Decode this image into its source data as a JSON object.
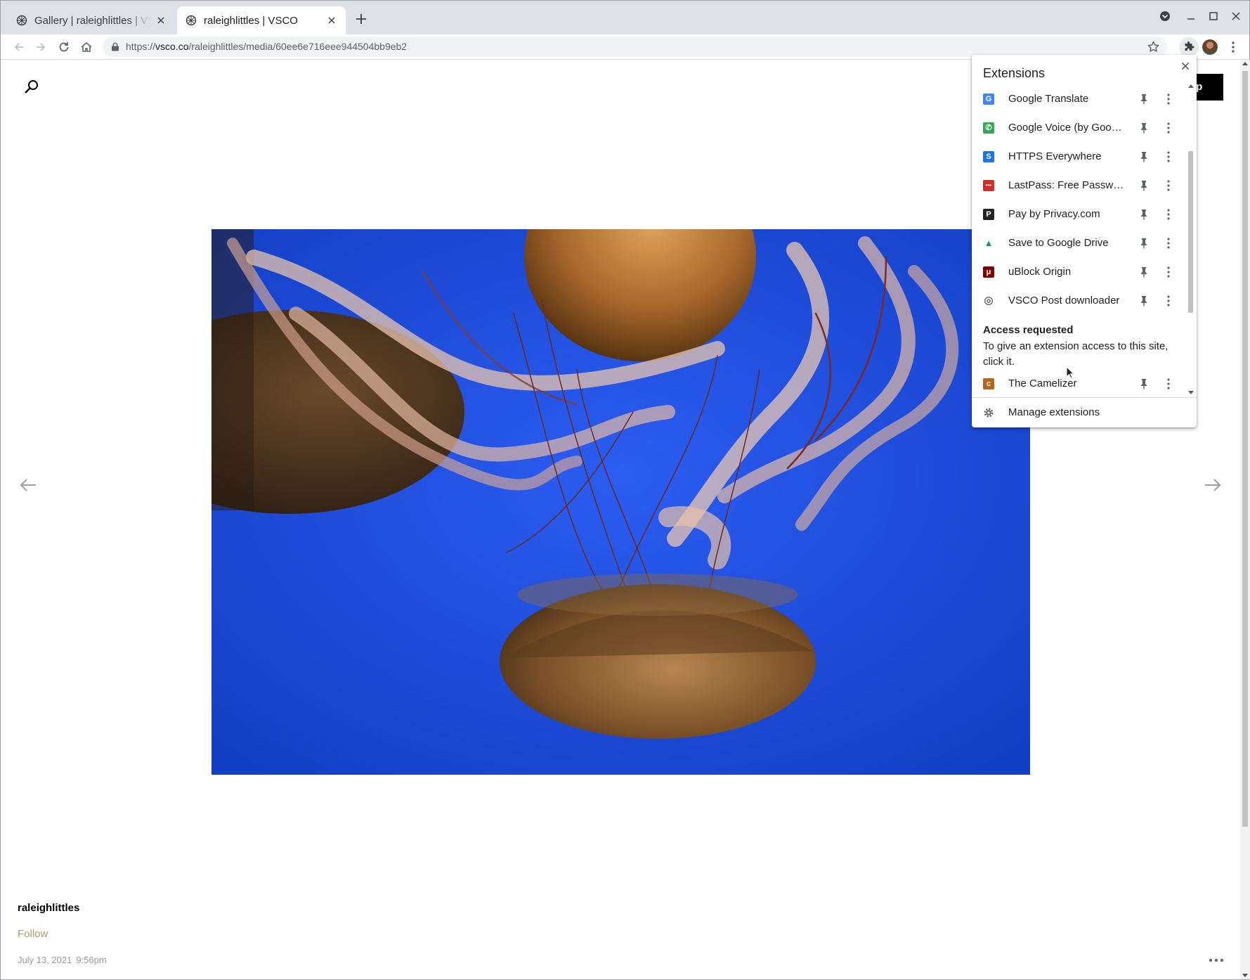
{
  "tabs": [
    {
      "title": "Gallery | raleighlittles | VSCO",
      "icon": "vsco-favicon-icon",
      "active": false
    },
    {
      "title": "raleighlittles | VSCO",
      "icon": "vsco-favicon-icon",
      "active": true
    }
  ],
  "address_bar": {
    "url_prefix": "https://",
    "url_host": "vsco.co",
    "url_path": "/raleighlittles/media/60ee6e716eee944504bb9eb2"
  },
  "page": {
    "app_button_label": "pp",
    "photo_alt": "jellyfish",
    "username": "raleighlittles",
    "follow_label": "Follow",
    "date": "July 13, 2021",
    "time": "9:56pm"
  },
  "extensions_popup": {
    "title": "Extensions",
    "items": [
      {
        "name": "Google Translate",
        "icon": "google-translate-icon",
        "color": "#4285f4",
        "glyph": "G"
      },
      {
        "name": "Google Voice (by Google)",
        "icon": "google-voice-icon",
        "color": "#34a853",
        "glyph": "✆"
      },
      {
        "name": "HTTPS Everywhere",
        "icon": "https-everywhere-icon",
        "color": "#1a73e8",
        "glyph": "S"
      },
      {
        "name": "LastPass: Free Password Manager",
        "icon": "lastpass-icon",
        "color": "#d32d27",
        "glyph": "•••"
      },
      {
        "name": "Pay by Privacy.com",
        "icon": "privacy-icon",
        "color": "#202124",
        "glyph": "P"
      },
      {
        "name": "Save to Google Drive",
        "icon": "google-drive-icon",
        "color": "#0f9d58",
        "glyph": "▲"
      },
      {
        "name": "uBlock Origin",
        "icon": "ublock-icon",
        "color": "#800000",
        "glyph": "μ"
      },
      {
        "name": "VSCO Post downloader",
        "icon": "vsco-downloader-icon",
        "color": "#6a6a6a",
        "glyph": "◎"
      }
    ],
    "access_title": "Access requested",
    "access_desc": "To give an extension access to this site, click it.",
    "access_items": [
      {
        "name": "The Camelizer",
        "icon": "camelizer-icon",
        "color": "#b5651d",
        "glyph": "c"
      }
    ],
    "manage_label": "Manage extensions"
  }
}
